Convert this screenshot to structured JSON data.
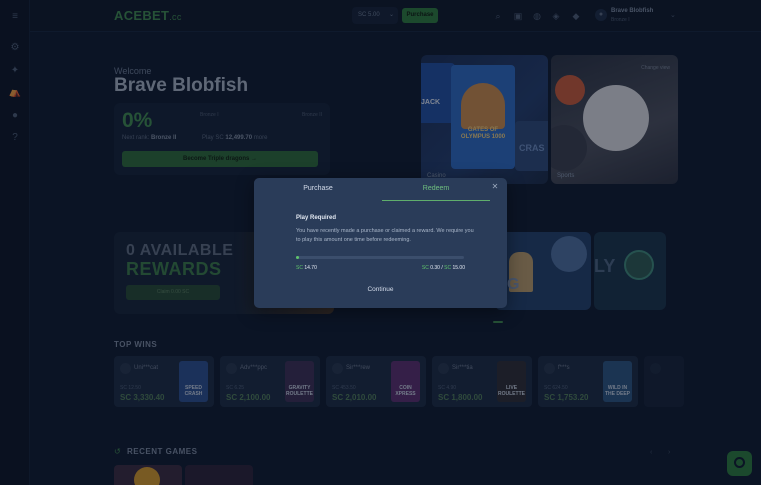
{
  "header": {
    "logo": "ACEBET",
    "logo_suffix": ".cc",
    "balance_currency": "SC",
    "balance_value": "5.00",
    "purchase_label": "Purchase",
    "user_name": "Brave Blobfish",
    "user_level": "Bronze I"
  },
  "welcome": {
    "greeting": "Welcome",
    "name": "Brave Blobfish",
    "progress_pct": "0%",
    "current_rank": "Bronze I",
    "next_rank_label": "Bronze II",
    "next_rank_prefix": "Next rank:",
    "next_rank_value": "Bronze II",
    "play_prefix": "Play SC",
    "play_amount": "12,499.70",
    "play_suffix": "more",
    "become_label": "Become Triple dragons"
  },
  "banners": {
    "casino_label": "Casino",
    "sports_label": "Sports",
    "change_view": "Change view",
    "slot_text": "GATES OF OLYMPUS 1000",
    "jack_text": "JACK",
    "crash_text": "CRAS"
  },
  "rewards": {
    "line1": "0 AVAILABLE",
    "line2": "REWARDS",
    "claim_label": "Claim 0.00 SC",
    "promo_text": "G",
    "promo_text2": "LY"
  },
  "top_wins": {
    "title": "TOP WINS",
    "items": [
      {
        "user": "Uni***cat",
        "small": "SC 12.50",
        "amount": "SC 3,330.40",
        "game": "SPEED CRASH",
        "bg": "#2a4f8f"
      },
      {
        "user": "Adv***ppc",
        "small": "SC 6.25",
        "amount": "SC 2,100.00",
        "game": "GRAVITY ROULETTE",
        "bg": "#3b2f55"
      },
      {
        "user": "Sir***rew",
        "small": "SC 453.50",
        "amount": "SC 2,010.00",
        "game": "COIN XPRESS",
        "bg": "#5a2f6d"
      },
      {
        "user": "Sir***tia",
        "small": "SC 4.90",
        "amount": "SC 1,800.00",
        "game": "LIVE ROULETTE",
        "bg": "#2d2d33"
      },
      {
        "user": "f***s",
        "small": "SC 624.50",
        "amount": "SC 1,753.20",
        "game": "WILD IN THE DEEP",
        "bg": "#2b5580"
      }
    ]
  },
  "recent": {
    "title": "RECENT GAMES"
  },
  "modal": {
    "tab_purchase": "Purchase",
    "tab_redeem": "Redeem",
    "title": "Play Required",
    "description": "You have recently made a purchase or claimed a reward. We require you to play this amount one time before redeeming.",
    "progress_fraction": 0.02,
    "left_currency": "SC",
    "left_value": "14.70",
    "right_currency1": "SC",
    "right_value1": "0.30",
    "right_sep": "/",
    "right_currency2": "SC",
    "right_value2": "15.00",
    "continue_label": "Continue"
  },
  "colors": {
    "accent": "#3f8a4f",
    "modal_bg": "#2a3c59",
    "progress": "#5fc46c",
    "page_bg": "#0e1a2e"
  },
  "icons": [
    "menu-icon",
    "settings-icon",
    "puzzle-icon",
    "tent-icon",
    "user-icon",
    "help-icon",
    "search-icon",
    "gift-icon",
    "chat-icon",
    "mega-icon",
    "bell-icon",
    "close-icon",
    "chevron-down-icon"
  ]
}
